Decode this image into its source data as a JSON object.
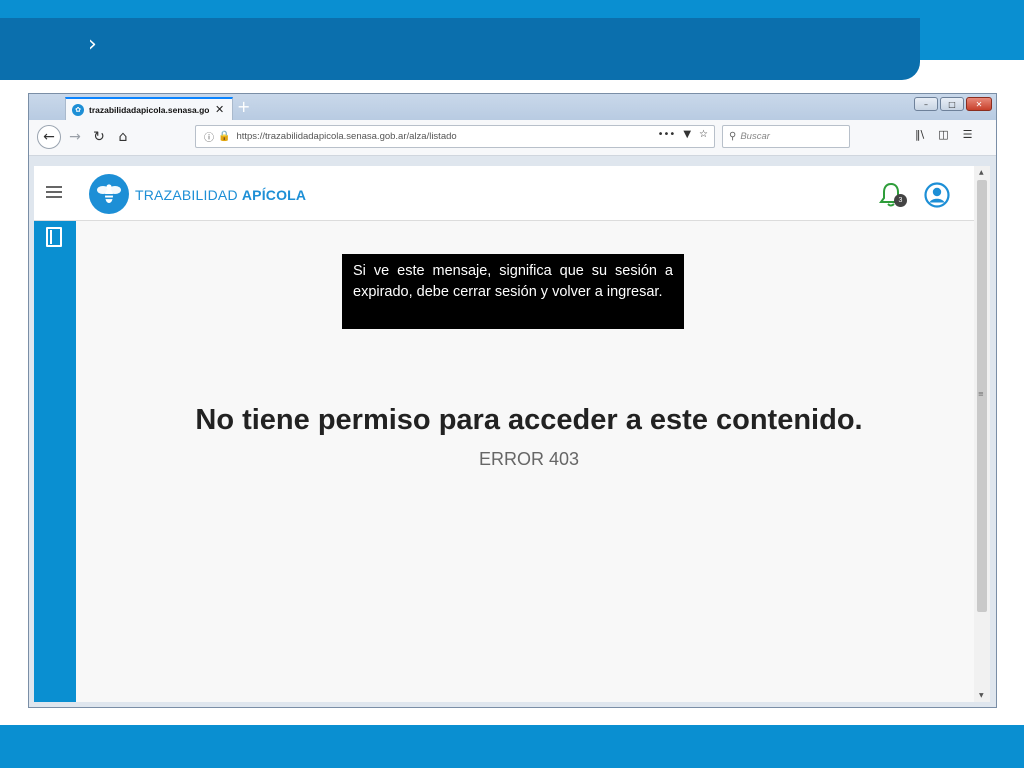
{
  "slide": {
    "chevron": "›"
  },
  "browser": {
    "tab_title": "trazabilidadapicola.senasa.gob.ar",
    "tab_close": "✕",
    "new_tab": "+",
    "url": "https://trazabilidadapicola.senasa.gob.ar/alza/listado",
    "url_menu": "•••",
    "search_placeholder": "Buscar",
    "window_buttons": {
      "minimize": "–",
      "maximize": "□",
      "close": "✕"
    }
  },
  "app": {
    "brand_regular": "TRAZABILIDAD ",
    "brand_bold": "APÍCOLA",
    "notification_count": "3"
  },
  "content": {
    "notice": "Si ve este mensaje, significa que su sesión a expirado, debe cerrar sesión y volver a ingresar.",
    "error_title": "No tiene permiso para acceder a este contenido.",
    "error_code": "ERROR 403"
  },
  "colors": {
    "brand_blue": "#1d8fd6",
    "slide_blue": "#0a8fd1",
    "slide_dark_blue": "#0b6fad",
    "bell_green": "#2e9d3a"
  }
}
